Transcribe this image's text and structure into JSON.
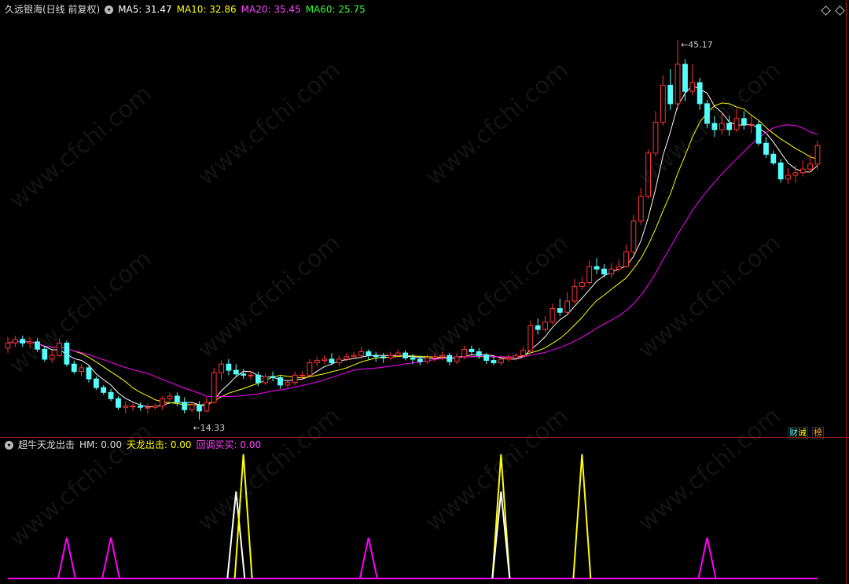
{
  "main_header": {
    "title": "久远银海(日线 前复权)",
    "ma5": "MA5: 31.47",
    "ma10": "MA10: 32.86",
    "ma20": "MA20: 35.45",
    "ma60": "MA60: 25.75"
  },
  "indicator_header": {
    "name": "超牛天龙出击",
    "hm": "HM: 0.00",
    "tianlong": "天龙出击: 0.00",
    "huitiao": "回调买买: 0.00"
  },
  "tags": {
    "caiwu": "财",
    "jie": "诫",
    "bang": "榜"
  },
  "annotations": {
    "high": "45.17",
    "low": "14.33"
  },
  "watermark": "www.cfchi.com",
  "colors": {
    "ma5": "#ffffff",
    "ma10": "#ffff00",
    "ma20": "#ff00ff",
    "ma60": "#00ff00",
    "up": "#ff3232",
    "down": "#54ffff",
    "divider": "#9b1b1b"
  },
  "chart_data": {
    "type": "candlestick",
    "price_range": [
      13.5,
      47.0
    ],
    "candles": [
      [
        20.2,
        20.6,
        21.1,
        19.8
      ],
      [
        20.6,
        20.9,
        21.2,
        20.3
      ],
      [
        20.9,
        20.6,
        21.2,
        20.3
      ],
      [
        20.6,
        20.7,
        21.1,
        20.2
      ],
      [
        20.7,
        20.1,
        21.0,
        19.9
      ],
      [
        20.1,
        19.3,
        20.4,
        19.1
      ],
      [
        19.3,
        19.6,
        20.0,
        19.0
      ],
      [
        19.6,
        20.6,
        21.0,
        19.5
      ],
      [
        20.6,
        18.9,
        20.8,
        18.7
      ],
      [
        18.9,
        18.3,
        19.2,
        18.1
      ],
      [
        18.3,
        18.6,
        18.9,
        17.9
      ],
      [
        18.6,
        17.7,
        18.8,
        17.4
      ],
      [
        17.7,
        17.0,
        17.9,
        16.8
      ],
      [
        17.0,
        16.6,
        17.2,
        16.4
      ],
      [
        16.6,
        16.1,
        16.9,
        15.9
      ],
      [
        16.1,
        15.4,
        16.3,
        15.2
      ],
      [
        15.4,
        15.5,
        15.9,
        14.9
      ],
      [
        15.5,
        15.5,
        15.8,
        15.1
      ],
      [
        15.5,
        15.4,
        15.8,
        15.1
      ],
      [
        15.4,
        15.4,
        15.7,
        14.9
      ],
      [
        15.4,
        15.5,
        15.7,
        15.2
      ],
      [
        15.5,
        16.1,
        16.3,
        15.2
      ],
      [
        16.1,
        16.3,
        16.6,
        15.9
      ],
      [
        16.3,
        15.8,
        16.6,
        15.5
      ],
      [
        15.8,
        15.2,
        16.2,
        14.9
      ],
      [
        15.2,
        15.6,
        15.8,
        15.0
      ],
      [
        15.6,
        15.1,
        15.9,
        14.4
      ],
      [
        15.1,
        15.8,
        16.2,
        15.0
      ],
      [
        15.8,
        18.2,
        18.6,
        15.7
      ],
      [
        18.2,
        18.9,
        19.2,
        17.6
      ],
      [
        18.9,
        18.4,
        19.3,
        18.0
      ],
      [
        18.4,
        18.1,
        18.9,
        17.8
      ],
      [
        18.1,
        18.0,
        18.5,
        17.7
      ],
      [
        18.0,
        18.0,
        18.4,
        17.6
      ],
      [
        18.0,
        17.4,
        18.3,
        17.1
      ],
      [
        17.4,
        17.9,
        18.1,
        17.2
      ],
      [
        17.9,
        17.8,
        18.3,
        17.5
      ],
      [
        17.8,
        17.2,
        18.0,
        16.9
      ],
      [
        17.2,
        17.4,
        17.7,
        17.0
      ],
      [
        17.4,
        18.0,
        18.3,
        17.2
      ],
      [
        18.0,
        18.0,
        18.3,
        17.7
      ],
      [
        18.0,
        19.0,
        19.3,
        17.8
      ],
      [
        19.0,
        19.2,
        19.5,
        18.7
      ],
      [
        19.2,
        19.3,
        19.6,
        18.9
      ],
      [
        19.3,
        19.0,
        19.8,
        18.8
      ],
      [
        19.0,
        19.3,
        19.6,
        18.7
      ],
      [
        19.3,
        19.5,
        19.8,
        19.1
      ],
      [
        19.5,
        19.6,
        19.9,
        19.3
      ],
      [
        19.6,
        19.9,
        20.3,
        19.3
      ],
      [
        19.9,
        19.6,
        20.1,
        19.2
      ],
      [
        19.6,
        19.5,
        19.9,
        19.1
      ],
      [
        19.5,
        19.4,
        19.8,
        19.0
      ],
      [
        19.4,
        19.6,
        19.9,
        19.2
      ],
      [
        19.6,
        19.8,
        20.1,
        19.4
      ],
      [
        19.8,
        19.4,
        20.0,
        19.2
      ],
      [
        19.4,
        19.3,
        19.7,
        18.9
      ],
      [
        19.3,
        19.1,
        19.6,
        18.8
      ],
      [
        19.1,
        19.4,
        19.7,
        18.9
      ],
      [
        19.4,
        19.5,
        19.8,
        19.1
      ],
      [
        19.5,
        19.6,
        19.9,
        19.2
      ],
      [
        19.6,
        19.1,
        19.8,
        18.8
      ],
      [
        19.1,
        19.5,
        19.8,
        18.9
      ],
      [
        19.5,
        20.1,
        20.4,
        19.3
      ],
      [
        20.1,
        19.9,
        20.4,
        19.6
      ],
      [
        19.9,
        19.6,
        20.2,
        19.3
      ],
      [
        19.6,
        19.2,
        19.8,
        18.9
      ],
      [
        19.2,
        19.0,
        19.5,
        18.8
      ],
      [
        19.0,
        19.3,
        19.6,
        18.8
      ],
      [
        19.3,
        19.4,
        19.7,
        19.1
      ],
      [
        19.4,
        19.6,
        19.8,
        19.2
      ],
      [
        19.6,
        20.0,
        20.3,
        19.4
      ],
      [
        20.0,
        22.0,
        22.4,
        19.8
      ],
      [
        22.0,
        21.7,
        22.6,
        21.3
      ],
      [
        21.7,
        22.3,
        22.8,
        21.5
      ],
      [
        22.3,
        23.4,
        23.8,
        22.1
      ],
      [
        23.4,
        23.1,
        24.2,
        22.8
      ],
      [
        23.1,
        24.0,
        24.7,
        22.9
      ],
      [
        24.0,
        25.2,
        25.8,
        23.8
      ],
      [
        25.2,
        25.5,
        26.0,
        24.9
      ],
      [
        25.5,
        26.8,
        27.3,
        25.3
      ],
      [
        26.8,
        26.6,
        27.5,
        26.2
      ],
      [
        26.6,
        26.2,
        27.0,
        25.9
      ],
      [
        26.2,
        26.6,
        27.1,
        25.9
      ],
      [
        26.6,
        26.8,
        27.4,
        26.4
      ],
      [
        26.8,
        28.0,
        28.6,
        26.7
      ],
      [
        28.0,
        30.5,
        31.0,
        27.8
      ],
      [
        30.5,
        32.5,
        33.2,
        30.2
      ],
      [
        32.5,
        36.0,
        36.3,
        32.3
      ],
      [
        36.0,
        38.5,
        39.4,
        35.7
      ],
      [
        38.5,
        41.5,
        42.3,
        38.2
      ],
      [
        41.5,
        40.0,
        42.8,
        39.5
      ],
      [
        40.0,
        43.2,
        45.17,
        39.5
      ],
      [
        43.2,
        41.0,
        43.6,
        40.2
      ],
      [
        41.0,
        41.7,
        43.2,
        40.7
      ],
      [
        41.7,
        40.0,
        42.1,
        39.5
      ],
      [
        40.0,
        38.4,
        40.3,
        38.0
      ],
      [
        38.4,
        37.9,
        39.0,
        37.3
      ],
      [
        37.9,
        38.4,
        39.3,
        37.5
      ],
      [
        38.4,
        37.9,
        39.0,
        37.4
      ],
      [
        37.9,
        38.8,
        39.6,
        37.7
      ],
      [
        38.8,
        38.3,
        39.4,
        37.9
      ],
      [
        38.3,
        38.3,
        39.0,
        37.6
      ],
      [
        38.3,
        36.8,
        38.6,
        36.6
      ],
      [
        36.8,
        35.9,
        37.3,
        35.6
      ],
      [
        35.9,
        35.2,
        36.2,
        35.0
      ],
      [
        35.2,
        33.9,
        35.5,
        33.6
      ],
      [
        33.9,
        34.2,
        34.8,
        33.5
      ],
      [
        34.2,
        34.4,
        35.0,
        33.6
      ],
      [
        34.4,
        34.7,
        35.4,
        34.1
      ],
      [
        34.7,
        35.1,
        35.9,
        34.4
      ],
      [
        35.1,
        36.6,
        37.0,
        34.6
      ]
    ],
    "indicator_spikes": [
      {
        "index": 8,
        "color": "#ff00ff",
        "height": 0.33
      },
      {
        "index": 14,
        "color": "#ff00ff",
        "height": 0.33
      },
      {
        "index": 31,
        "color": "#ffffff",
        "height": 0.7
      },
      {
        "index": 32,
        "color": "#ffff00",
        "height": 1.0
      },
      {
        "index": 49,
        "color": "#ff00ff",
        "height": 0.33
      },
      {
        "index": 67,
        "color": "#ffff00",
        "height": 1.0
      },
      {
        "index": 67,
        "color": "#ffffff",
        "height": 0.7
      },
      {
        "index": 78,
        "color": "#ffff00",
        "height": 1.0
      },
      {
        "index": 95,
        "color": "#ff00ff",
        "height": 0.33
      }
    ]
  }
}
